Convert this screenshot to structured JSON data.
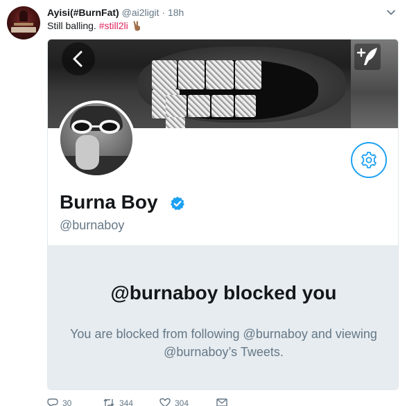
{
  "tweet": {
    "display_name": "Ayisi(#BurnFat)",
    "handle": "@ai2ligit",
    "separator": "·",
    "time": "18h",
    "text": "Still balling.",
    "hashtag": "#still2li",
    "emoji_icon": "victory-hand-icon",
    "menu_icon": "chevron-down-icon"
  },
  "profile_card": {
    "back_icon": "chevron-left-icon",
    "compose_icon": "quill-plus-icon",
    "settings_icon": "gear-icon",
    "name": "Burna Boy",
    "verified_icon": "verified-badge-icon",
    "handle": "@burnaboy",
    "blocked_title": "@burnaboy blocked you",
    "blocked_message": "You are blocked from following @burnaboy and viewing @burnaboy’s Tweets."
  },
  "actions": {
    "reply_count": "30",
    "retweet_count": "344",
    "like_count": "304"
  },
  "colors": {
    "accent": "#1da1f2",
    "hashtag": "#e0245e",
    "muted": "#657786",
    "panel": "#e6ecf0"
  }
}
